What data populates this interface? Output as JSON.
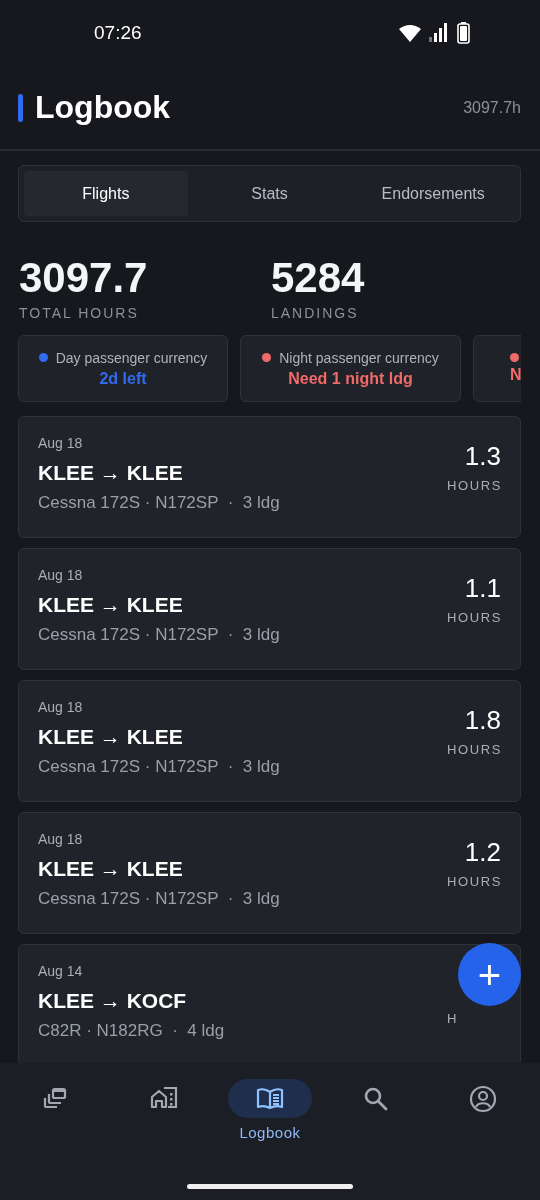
{
  "status_bar": {
    "time": "07:26"
  },
  "header": {
    "title": "Logbook",
    "total": "3097.7h"
  },
  "tabs": [
    {
      "label": "Flights",
      "selected": true
    },
    {
      "label": "Stats",
      "selected": false
    },
    {
      "label": "Endorsements",
      "selected": false
    }
  ],
  "stats": [
    {
      "value": "3097.7",
      "label": "TOTAL HOURS"
    },
    {
      "value": "5284",
      "label": "LANDINGS"
    }
  ],
  "currency": [
    {
      "label": "Day passenger currency",
      "status": "2d left",
      "color": "#2f6cf0"
    },
    {
      "label": "Night passenger currency",
      "status": "Need 1 night ldg",
      "color": "#f06a6a"
    },
    {
      "status": "N",
      "color": "#f06a6a"
    }
  ],
  "flights": [
    {
      "date": "Aug 18",
      "route": "KLEE → KLEE",
      "details": "Cessna 172S · N172SP  ·  3 ldg",
      "hours": "1.3",
      "unit": "HOURS"
    },
    {
      "date": "Aug 18",
      "route": "KLEE → KLEE",
      "details": "Cessna 172S · N172SP  ·  3 ldg",
      "hours": "1.1",
      "unit": "HOURS"
    },
    {
      "date": "Aug 18",
      "route": "KLEE → KLEE",
      "details": "Cessna 172S · N172SP  ·  3 ldg",
      "hours": "1.8",
      "unit": "HOURS"
    },
    {
      "date": "Aug 18",
      "route": "KLEE → KLEE",
      "details": "Cessna 172S · N172SP  ·  3 ldg",
      "hours": "1.2",
      "unit": "HOURS"
    },
    {
      "date": "Aug 14",
      "route": "KLEE → KOCF",
      "details": "C82R · N182RG  ·  4 ldg",
      "unit": "H"
    }
  ],
  "fab": {
    "label": "+"
  },
  "nav": [
    {
      "kind": "stack",
      "selected": false
    },
    {
      "kind": "buildings",
      "selected": false
    },
    {
      "kind": "book",
      "selected": true,
      "label": "Logbook"
    },
    {
      "kind": "search",
      "selected": false
    },
    {
      "kind": "account",
      "selected": false
    }
  ]
}
